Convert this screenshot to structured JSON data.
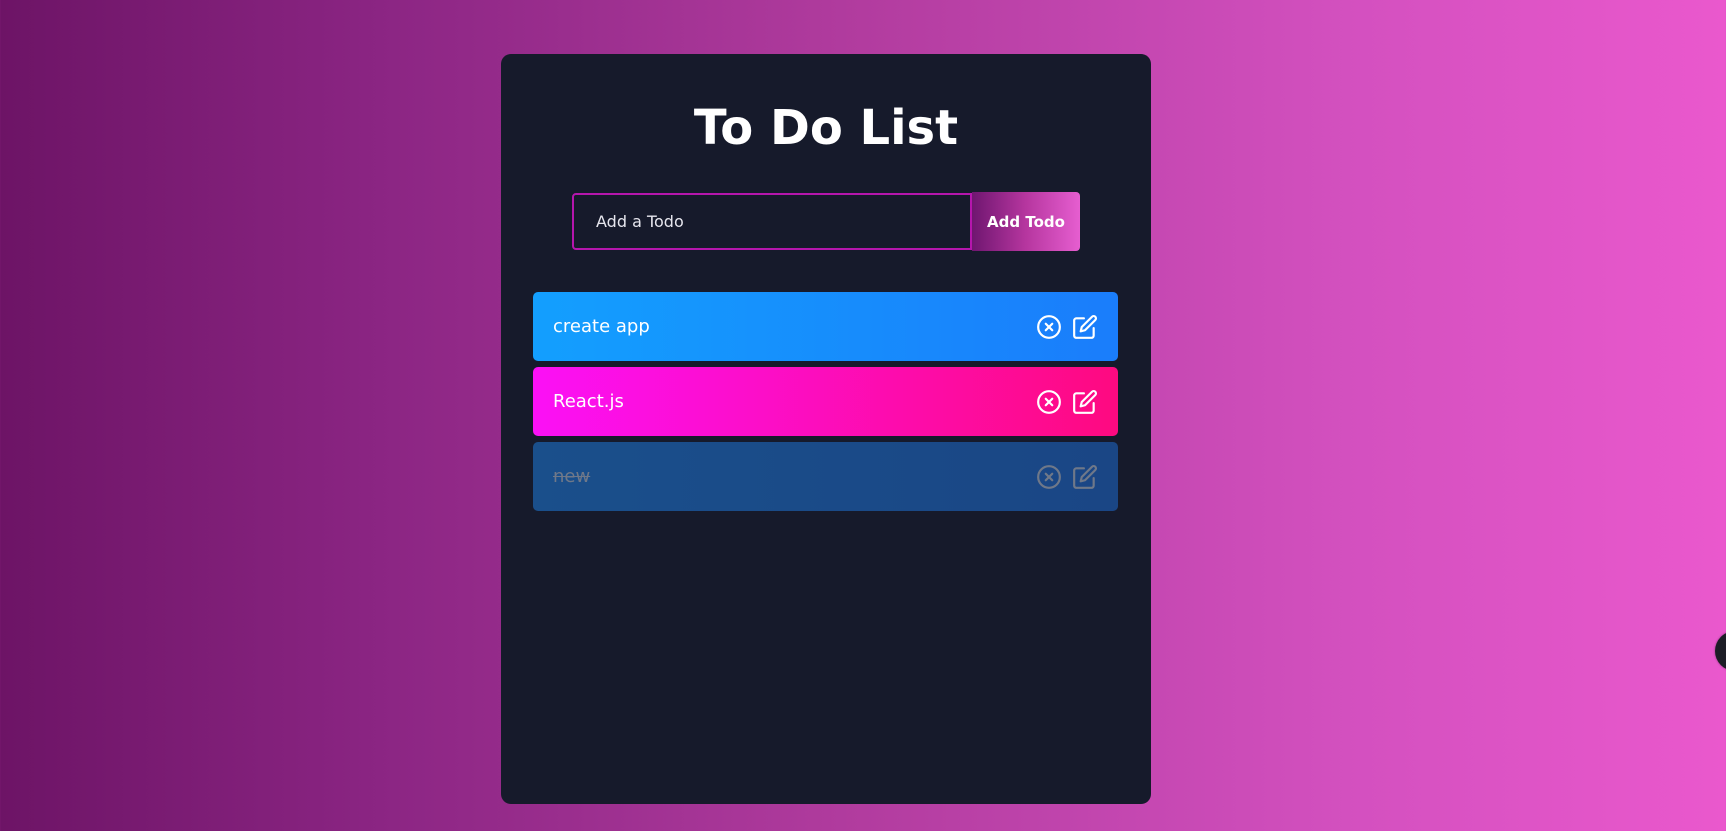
{
  "app": {
    "title": "To Do List"
  },
  "form": {
    "input_placeholder": "Add a Todo",
    "input_value": "",
    "submit_label": "Add Todo"
  },
  "todos": [
    {
      "text": "create app",
      "completed": false,
      "color": "#139ffe"
    },
    {
      "text": "React.js",
      "completed": false,
      "color": "#fb10f6"
    },
    {
      "text": "new",
      "completed": true,
      "color": "#1a4f8b"
    }
  ],
  "icons": {
    "delete": "close-circle-icon",
    "edit": "edit-icon"
  },
  "colors": {
    "panel_background": "#161a2b",
    "input_border": "#b516ad"
  }
}
